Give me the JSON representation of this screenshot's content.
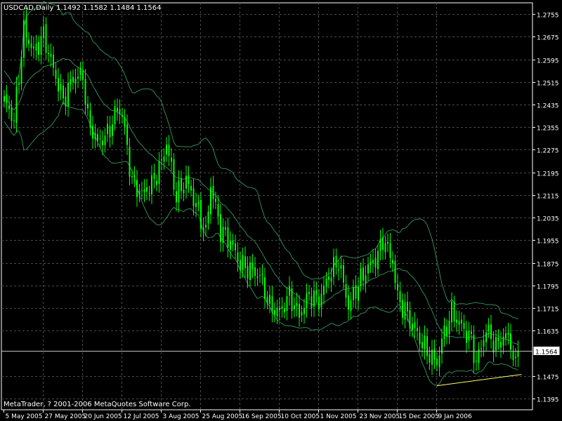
{
  "header": {
    "symbol_timeframe": "USDCAD,Daily",
    "ohlc": "1.1492 1.1582 1.1484 1.1564"
  },
  "footer": {
    "copyright": "MetaTrader, ? 2001-2006 MetaQuotes Software Corp."
  },
  "colors": {
    "background": "#000000",
    "grid": "#4a4a4a",
    "frame": "#ffffff",
    "candle": "#00ff00",
    "band": "#2e8b57",
    "trendline": "#ffff66",
    "price_line": "#c0c0c0",
    "text": "#ffffff"
  },
  "chart_data": {
    "type": "candlestick",
    "title": "USDCAD,Daily",
    "y_ticks": [
      "1.2755",
      "1.2675",
      "1.2595",
      "1.2515",
      "1.2435",
      "1.2355",
      "1.2275",
      "1.2195",
      "1.2115",
      "1.2035",
      "1.1955",
      "1.1875",
      "1.1795",
      "1.1715",
      "1.1635",
      "1.1475",
      "1.1395"
    ],
    "ylim": [
      1.1355,
      1.2795
    ],
    "x_ticks": [
      "5 May 2005",
      "27 May 2005",
      "20 Jun 2005",
      "12 Jul 2005",
      "3 Aug 2005",
      "25 Aug 2005",
      "16 Sep 2005",
      "10 Oct 2005",
      "1 Nov 2005",
      "23 Nov 2005",
      "15 Dec 2005",
      "9 Jan 2006"
    ],
    "bars_per_tick": 16,
    "current_price": "1.1564",
    "grid": true,
    "trendline": {
      "start_bar": 176,
      "start_price": 1.144,
      "end_bar": 209,
      "end_price": 1.148
    },
    "close_anchors": [
      [
        0,
        1.245
      ],
      [
        4,
        1.238
      ],
      [
        8,
        1.27
      ],
      [
        12,
        1.262
      ],
      [
        16,
        1.268
      ],
      [
        20,
        1.256
      ],
      [
        24,
        1.245
      ],
      [
        28,
        1.253
      ],
      [
        32,
        1.254
      ],
      [
        34,
        1.238
      ],
      [
        38,
        1.23
      ],
      [
        42,
        1.233
      ],
      [
        46,
        1.242
      ],
      [
        48,
        1.24
      ],
      [
        52,
        1.216
      ],
      [
        56,
        1.212
      ],
      [
        60,
        1.215
      ],
      [
        64,
        1.223
      ],
      [
        66,
        1.23
      ],
      [
        70,
        1.211
      ],
      [
        74,
        1.217
      ],
      [
        78,
        1.208
      ],
      [
        82,
        1.198
      ],
      [
        84,
        1.215
      ],
      [
        88,
        1.199
      ],
      [
        92,
        1.195
      ],
      [
        96,
        1.187
      ],
      [
        100,
        1.185
      ],
      [
        104,
        1.183
      ],
      [
        108,
        1.172
      ],
      [
        112,
        1.17
      ],
      [
        116,
        1.176
      ],
      [
        120,
        1.169
      ],
      [
        124,
        1.176
      ],
      [
        128,
        1.174
      ],
      [
        132,
        1.183
      ],
      [
        136,
        1.188
      ],
      [
        140,
        1.172
      ],
      [
        144,
        1.18
      ],
      [
        148,
        1.186
      ],
      [
        152,
        1.19
      ],
      [
        154,
        1.196
      ],
      [
        158,
        1.188
      ],
      [
        160,
        1.175
      ],
      [
        164,
        1.169
      ],
      [
        168,
        1.162
      ],
      [
        172,
        1.156
      ],
      [
        176,
        1.152
      ],
      [
        178,
        1.16
      ],
      [
        182,
        1.17
      ],
      [
        186,
        1.165
      ],
      [
        190,
        1.16
      ],
      [
        192,
        1.152
      ],
      [
        196,
        1.164
      ],
      [
        200,
        1.158
      ],
      [
        204,
        1.162
      ],
      [
        206,
        1.159
      ],
      [
        208,
        1.15
      ],
      [
        209,
        1.1564
      ]
    ],
    "bands": {
      "period": 20,
      "deviations": 2
    }
  }
}
